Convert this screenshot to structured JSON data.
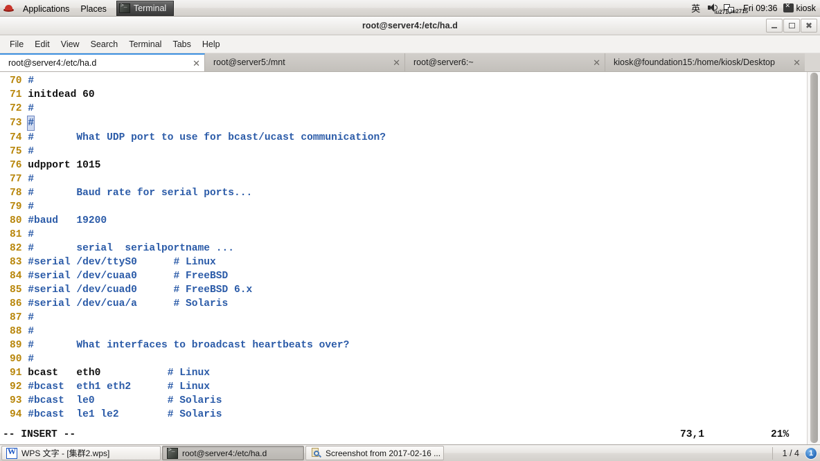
{
  "top_panel": {
    "logo_icon": "redhat-logo-icon",
    "menus": [
      {
        "label": "Applications",
        "name": "applications-menu"
      },
      {
        "label": "Places",
        "name": "places-menu"
      }
    ],
    "window_button": {
      "label": "Terminal",
      "icon": "terminal-icon"
    },
    "input_method": "英",
    "volume_icon": "volume-muted-icon",
    "network_icon": "network-disconnected-icon",
    "clock": "Fri 09:36",
    "user_icon": "user-icon",
    "username": "kiosk"
  },
  "window": {
    "title": "root@server4:/etc/ha.d",
    "controls": [
      {
        "name": "minimize-button",
        "label": "–"
      },
      {
        "name": "maximize-button",
        "label": "□"
      },
      {
        "name": "close-button",
        "label": "✕"
      }
    ],
    "menubar": [
      "File",
      "Edit",
      "View",
      "Search",
      "Terminal",
      "Tabs",
      "Help"
    ],
    "tabs": [
      {
        "label": "root@server4:/etc/ha.d",
        "active": true,
        "close": "✕"
      },
      {
        "label": "root@server5:/mnt",
        "active": false,
        "close": "✕"
      },
      {
        "label": "root@server6:~",
        "active": false,
        "close": "✕"
      },
      {
        "label": "kiosk@foundation15:/home/kiosk/Desktop",
        "active": false,
        "close": "✕"
      }
    ]
  },
  "editor": {
    "colors": {
      "line_number": "#b8860b",
      "comment": "#2b5ba8",
      "text": "#111111",
      "background": "#ffffff",
      "cursor": "#cfdaf0"
    },
    "lines": [
      {
        "num": "70",
        "segments": [
          {
            "t": "#",
            "c": "cmt"
          }
        ]
      },
      {
        "num": "71",
        "segments": [
          {
            "t": "initdead 60",
            "c": "txt"
          }
        ]
      },
      {
        "num": "72",
        "segments": [
          {
            "t": "#",
            "c": "cmt"
          }
        ]
      },
      {
        "num": "73",
        "segments": [
          {
            "t": "#",
            "c": "cursor"
          }
        ]
      },
      {
        "num": "74",
        "segments": [
          {
            "t": "#       What UDP port to use for bcast/ucast communication?",
            "c": "cmt"
          }
        ]
      },
      {
        "num": "75",
        "segments": [
          {
            "t": "#",
            "c": "cmt"
          }
        ]
      },
      {
        "num": "76",
        "segments": [
          {
            "t": "udpport 1015",
            "c": "txt"
          }
        ]
      },
      {
        "num": "77",
        "segments": [
          {
            "t": "#",
            "c": "cmt"
          }
        ]
      },
      {
        "num": "78",
        "segments": [
          {
            "t": "#       Baud rate for serial ports...",
            "c": "cmt"
          }
        ]
      },
      {
        "num": "79",
        "segments": [
          {
            "t": "#",
            "c": "cmt"
          }
        ]
      },
      {
        "num": "80",
        "segments": [
          {
            "t": "#baud   19200",
            "c": "cmt"
          }
        ]
      },
      {
        "num": "81",
        "segments": [
          {
            "t": "#",
            "c": "cmt"
          }
        ]
      },
      {
        "num": "82",
        "segments": [
          {
            "t": "#       serial  serialportname ...",
            "c": "cmt"
          }
        ]
      },
      {
        "num": "83",
        "segments": [
          {
            "t": "#serial /dev/ttyS0      # Linux",
            "c": "cmt"
          }
        ]
      },
      {
        "num": "84",
        "segments": [
          {
            "t": "#serial /dev/cuaa0      # FreeBSD",
            "c": "cmt"
          }
        ]
      },
      {
        "num": "85",
        "segments": [
          {
            "t": "#serial /dev/cuad0      # FreeBSD 6.x",
            "c": "cmt"
          }
        ]
      },
      {
        "num": "86",
        "segments": [
          {
            "t": "#serial /dev/cua/a      # Solaris",
            "c": "cmt"
          }
        ]
      },
      {
        "num": "87",
        "segments": [
          {
            "t": "#",
            "c": "cmt"
          }
        ]
      },
      {
        "num": "88",
        "segments": [
          {
            "t": "#",
            "c": "cmt"
          }
        ]
      },
      {
        "num": "89",
        "segments": [
          {
            "t": "#       What interfaces to broadcast heartbeats over?",
            "c": "cmt"
          }
        ]
      },
      {
        "num": "90",
        "segments": [
          {
            "t": "#",
            "c": "cmt"
          }
        ]
      },
      {
        "num": "91",
        "segments": [
          {
            "t": "bcast   eth0           ",
            "c": "txt"
          },
          {
            "t": "# Linux",
            "c": "cmt"
          }
        ]
      },
      {
        "num": "92",
        "segments": [
          {
            "t": "#bcast  eth1 eth2      # Linux",
            "c": "cmt"
          }
        ]
      },
      {
        "num": "93",
        "segments": [
          {
            "t": "#bcast  le0            # Solaris",
            "c": "cmt"
          }
        ]
      },
      {
        "num": "94",
        "segments": [
          {
            "t": "#bcast  le1 le2        # Solaris",
            "c": "cmt"
          }
        ]
      }
    ],
    "status": {
      "mode": "-- INSERT --",
      "position": "73,1",
      "percent": "21%"
    }
  },
  "taskbar": {
    "items": [
      {
        "label": "WPS 文字 - [集群2.wps]",
        "icon": "wps-writer-icon",
        "active": false
      },
      {
        "label": "root@server4:/etc/ha.d",
        "icon": "terminal-icon",
        "active": true
      },
      {
        "label": "Screenshot from 2017-02-16 ...",
        "icon": "image-viewer-icon",
        "active": false
      }
    ],
    "workspace_count": "1 / 4",
    "workspace_badge": "1"
  }
}
